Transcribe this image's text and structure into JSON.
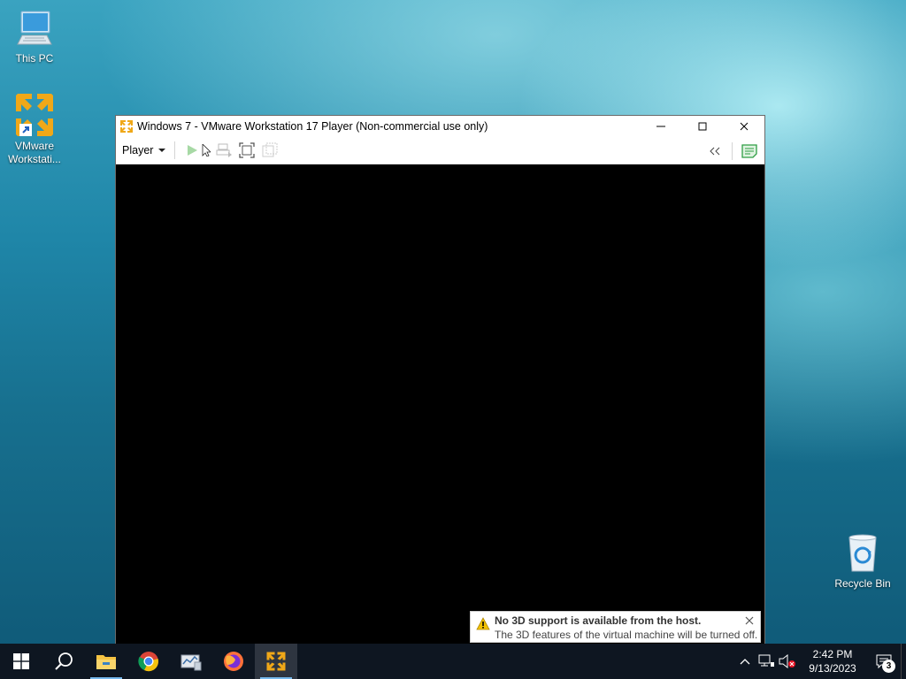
{
  "desktop": {
    "icons": [
      {
        "label": "This PC",
        "icon": "this-pc-icon"
      },
      {
        "label": "VMware Workstati...",
        "icon": "vmware-icon"
      },
      {
        "label": "Recycle Bin",
        "icon": "recycle-bin-icon"
      }
    ]
  },
  "window": {
    "title": "Windows 7 - VMware Workstation 17 Player (Non-commercial use only)",
    "icon": "vmware-icon",
    "controls": [
      "minimize-icon",
      "maximize-icon",
      "close-icon"
    ]
  },
  "toolbar": {
    "player_label": "Player",
    "buttons": [
      "play-icon",
      "play-dropdown-icon",
      "send-ctrl-alt-del-icon",
      "fit-guest-icon",
      "unity-icon"
    ],
    "right_buttons": [
      "collapse-toolbar-icon",
      "library-note-icon"
    ],
    "accent": "#2f9e44"
  },
  "notification": {
    "title": "No 3D support is available from the host.",
    "body": "The 3D features of the virtual machine will be turned off.",
    "icon": "warning-icon",
    "warn_color": "#f2c200"
  },
  "taskbar": {
    "items": [
      "start-icon",
      "search-icon",
      "file-explorer-icon",
      "chrome-icon",
      "server-manager-icon",
      "firefox-icon",
      "vmware-icon"
    ],
    "tray": [
      "show-hidden-icons-icon",
      "network-icon",
      "volume-muted-icon"
    ],
    "time": "2:42 PM",
    "date": "9/13/2023",
    "notification_count": "3"
  },
  "colors": {
    "taskbar_bg": "#0e1621",
    "window_bg": "#000000",
    "vmware_orange": "#f0a818",
    "running_indicator": "#76b9ed"
  }
}
